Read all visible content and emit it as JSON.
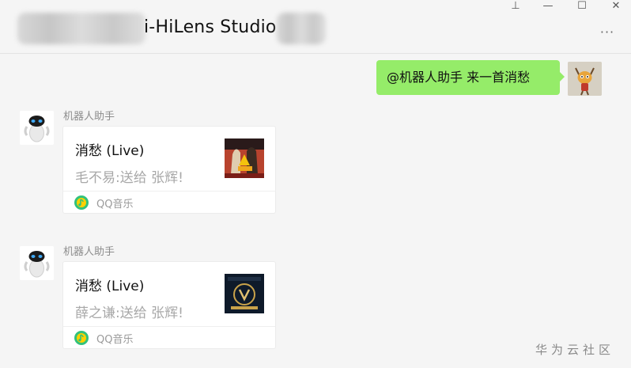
{
  "header": {
    "title": "i-HiLens Studio",
    "window_controls": {
      "pin": "⊥",
      "minimize": "—",
      "maximize": "☐",
      "close": "✕",
      "more": "···"
    }
  },
  "messages": [
    {
      "type": "sent",
      "text": "@机器人助手 来一首消愁"
    },
    {
      "type": "music_card",
      "sender": "机器人助手",
      "title": "消愁 (Live)",
      "description": "毛不易:送给 张辉!",
      "source": "QQ音乐"
    },
    {
      "type": "music_card",
      "sender": "机器人助手",
      "title": "消愁 (Live)",
      "description": "薛之谦:送给 张辉!",
      "source": "QQ音乐"
    }
  ],
  "watermark": "华为云社区",
  "colors": {
    "background": "#f5f5f5",
    "sent_bubble": "#95ec69",
    "card_background": "#ffffff",
    "qq_music_green": "#31c27c",
    "qq_music_yellow": "#ffd100"
  },
  "icons": {
    "source_icon": "qq-music-icon",
    "menu": "more-dots-icon"
  }
}
